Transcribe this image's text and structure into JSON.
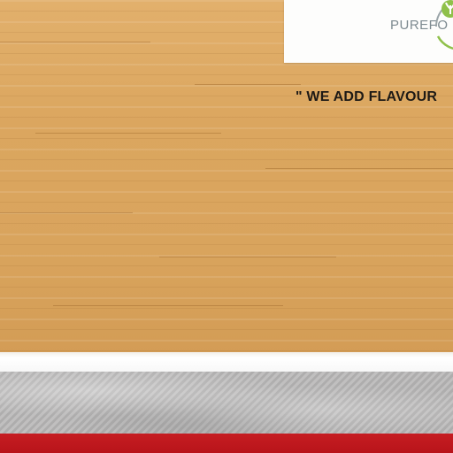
{
  "sign": {
    "brand_text": "PUREFO"
  },
  "slogan": {
    "text": "\" WE ADD FLAVOUR"
  },
  "colors": {
    "wood": "#dba65f",
    "sign_background": "#fdfdfc",
    "brand_text": "#7d8a90",
    "logo_green": "#8fc04a",
    "slogan_text": "#1e1a16",
    "floor": "#b9b8b8",
    "carpet": "#c61d22"
  },
  "icons": {
    "logo": "leaf-logo-icon"
  }
}
